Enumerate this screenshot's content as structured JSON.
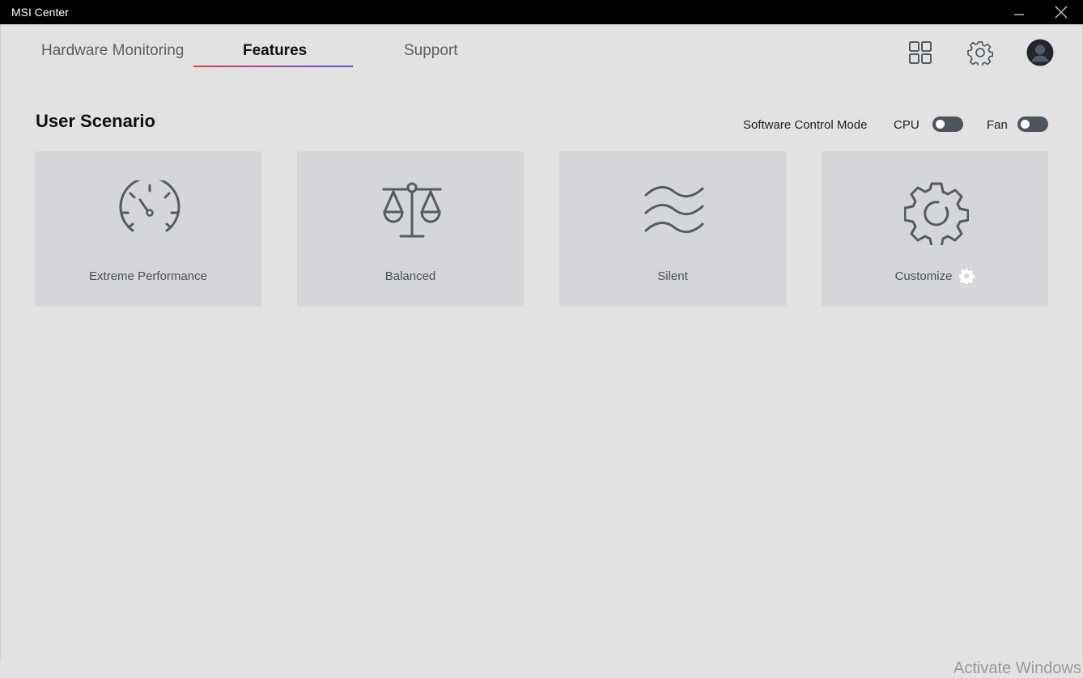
{
  "window": {
    "title": "MSI Center"
  },
  "tabs": [
    {
      "label": "Hardware Monitoring",
      "active": false
    },
    {
      "label": "Features",
      "active": true
    },
    {
      "label": "Support",
      "active": false
    }
  ],
  "toolbar_icons": [
    "apps-grid-icon",
    "gear-icon",
    "user-avatar-icon"
  ],
  "section": {
    "title": "User Scenario",
    "software_control_mode": "Software Control Mode",
    "cpu_label": "CPU",
    "fan_label": "Fan",
    "cpu_toggle_on": false,
    "fan_toggle_on": false
  },
  "scenarios": [
    {
      "label": "Extreme Performance",
      "icon": "speedometer-icon"
    },
    {
      "label": "Balanced",
      "icon": "scale-icon"
    },
    {
      "label": "Silent",
      "icon": "waves-icon"
    },
    {
      "label": "Customize",
      "icon": "gear-icon"
    }
  ],
  "watermark": "Activate Windows",
  "colors": {
    "accent_gradient_start": "#e23a4d",
    "accent_gradient_end": "#5a4fd8",
    "icon_stroke": "#545b64",
    "toggle": "#4f555d"
  }
}
